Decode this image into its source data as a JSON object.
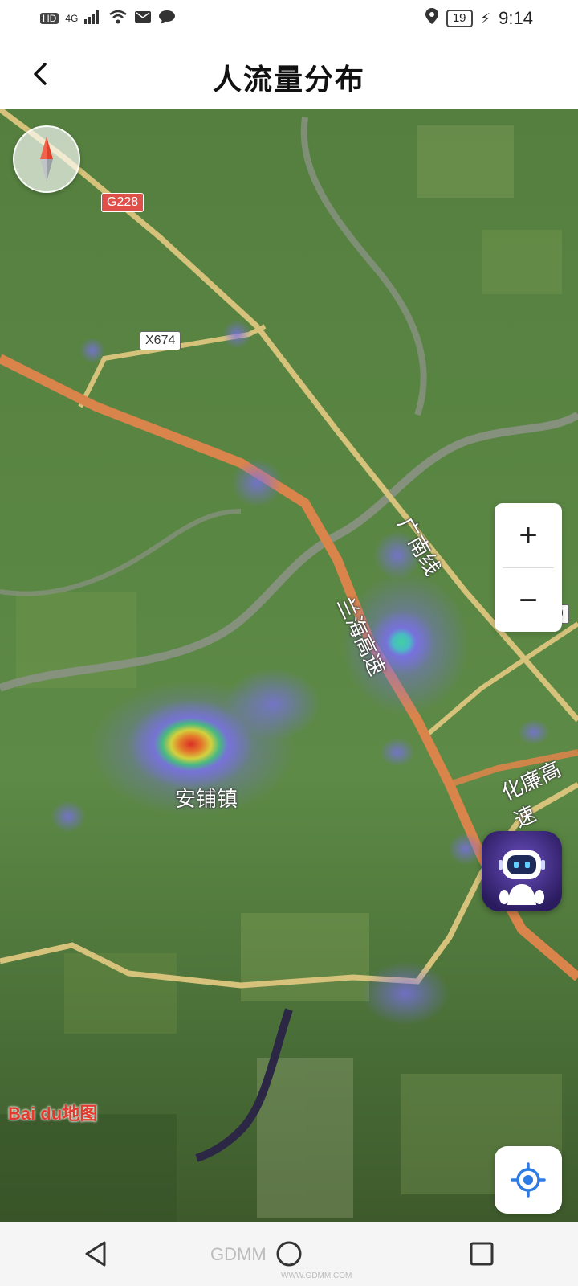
{
  "status_bar": {
    "left_indicators": [
      "HD",
      "4G"
    ],
    "battery": "19",
    "time": "9:14"
  },
  "header": {
    "title": "人流量分布"
  },
  "map": {
    "road_shields": [
      "G228",
      "X674",
      "380"
    ],
    "road_labels": [
      "广南线",
      "兰海高速",
      "化廉高速"
    ],
    "place_labels": [
      "安铺镇"
    ],
    "zoom_in": "+",
    "zoom_out": "−",
    "logo": "Bai du地图"
  },
  "watermark": {
    "text": "GDMM",
    "url": "WWW.GDMM.COM"
  },
  "colors": {
    "highway": "#d9844a",
    "road": "#d6c27a",
    "river": "#8a9283",
    "heat_low": "#7b6ef0",
    "heat_mid": "#38d08a",
    "heat_high": "#e63020"
  }
}
